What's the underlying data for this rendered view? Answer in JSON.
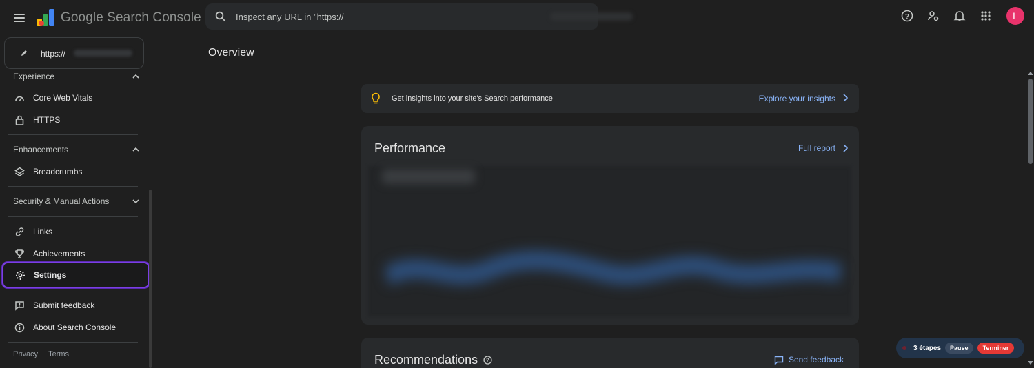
{
  "header": {
    "app_name": "Google Search Console",
    "search_placeholder": "Inspect any URL in \"https://",
    "avatar_letter": "L",
    "icons": [
      "menu-icon",
      "help-icon",
      "manage-users-icon",
      "notifications-icon",
      "apps-grid-icon"
    ]
  },
  "property": {
    "url": "https://"
  },
  "sidebar": {
    "experience": {
      "title": "Experience",
      "items": [
        {
          "label": "Core Web Vitals",
          "icon": "gauge-icon"
        },
        {
          "label": "HTTPS",
          "icon": "lock-icon"
        }
      ]
    },
    "enhancements": {
      "title": "Enhancements",
      "items": [
        {
          "label": "Breadcrumbs",
          "icon": "layers-icon"
        }
      ]
    },
    "security": {
      "title": "Security & Manual Actions"
    },
    "bottom_items": [
      {
        "label": "Links",
        "icon": "link-icon"
      },
      {
        "label": "Achievements",
        "icon": "trophy-icon"
      },
      {
        "label": "Settings",
        "icon": "gear-icon"
      },
      {
        "label": "Submit feedback",
        "icon": "feedback-icon"
      },
      {
        "label": "About Search Console",
        "icon": "info-icon"
      }
    ],
    "footer": {
      "privacy": "Privacy",
      "terms": "Terms"
    }
  },
  "main": {
    "title": "Overview",
    "insight_banner": {
      "text": "Get insights into your site's Search performance",
      "link": "Explore your insights"
    },
    "performance": {
      "title": "Performance",
      "link": "Full report"
    },
    "recommendations": {
      "title": "Recommendations",
      "feedback": "Send feedback"
    }
  },
  "recorder": {
    "steps": "3 étapes",
    "pause": "Pause",
    "end": "Terminer"
  },
  "colors": {
    "background": "#1f1f1f",
    "card": "#282a2c",
    "link": "#8ab4f8",
    "highlight": "#7b3fe4",
    "avatar": "#e8336b",
    "recorder_end": "#e53935"
  }
}
